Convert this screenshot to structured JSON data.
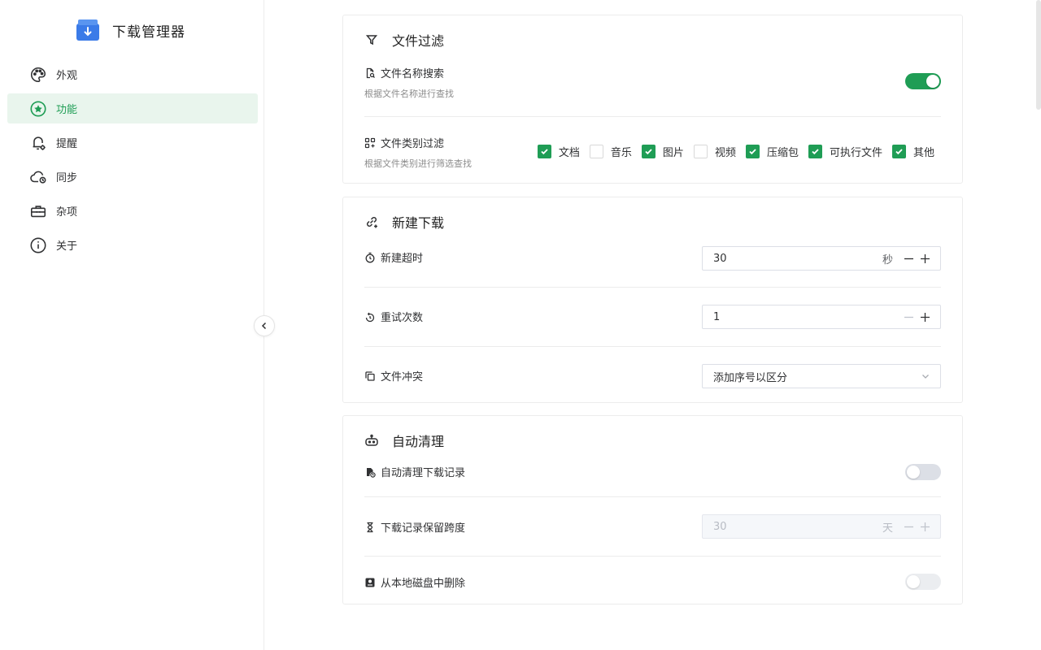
{
  "app": {
    "title": "下载管理器"
  },
  "sidebar": {
    "items": [
      {
        "label": "外观",
        "icon": "palette-icon"
      },
      {
        "label": "功能",
        "icon": "star-circle-icon",
        "active": true
      },
      {
        "label": "提醒",
        "icon": "bell-gear-icon"
      },
      {
        "label": "同步",
        "icon": "cloud-sync-icon"
      },
      {
        "label": "杂项",
        "icon": "toolbox-icon"
      },
      {
        "label": "关于",
        "icon": "info-icon"
      }
    ]
  },
  "sections": {
    "filter": {
      "title": "文件过滤",
      "name_search": {
        "label": "文件名称搜索",
        "desc": "根据文件名称进行查找",
        "enabled": true
      },
      "category": {
        "label": "文件类别过滤",
        "desc": "根据文件类别进行筛选查找",
        "options": [
          {
            "label": "文档",
            "checked": true
          },
          {
            "label": "音乐",
            "checked": false
          },
          {
            "label": "图片",
            "checked": true
          },
          {
            "label": "视频",
            "checked": false
          },
          {
            "label": "压缩包",
            "checked": true
          },
          {
            "label": "可执行文件",
            "checked": true
          },
          {
            "label": "其他",
            "checked": true
          }
        ]
      }
    },
    "new_download": {
      "title": "新建下载",
      "timeout": {
        "label": "新建超时",
        "value": "30",
        "unit": "秒"
      },
      "retry": {
        "label": "重试次数",
        "value": "1"
      },
      "conflict": {
        "label": "文件冲突",
        "value": "添加序号以区分"
      }
    },
    "auto_clean": {
      "title": "自动清理",
      "clean_records": {
        "label": "自动清理下载记录",
        "enabled": false
      },
      "retention": {
        "label": "下载记录保留跨度",
        "value": "30",
        "unit": "天"
      },
      "delete_local": {
        "label": "从本地磁盘中删除",
        "enabled": false
      }
    }
  },
  "colors": {
    "accent": "#1f9d55",
    "active_bg": "#e9f5ed",
    "logo": "#3b7be8"
  }
}
